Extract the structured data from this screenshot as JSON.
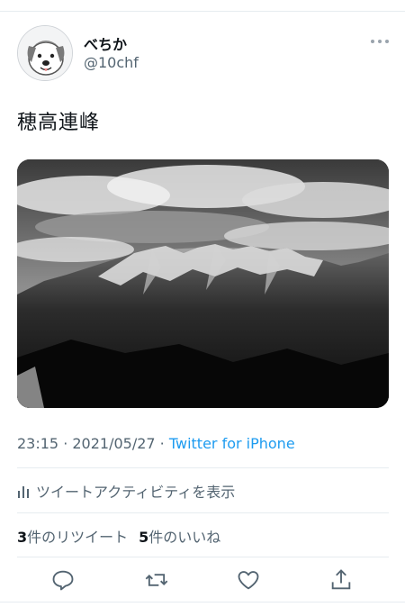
{
  "user": {
    "display_name": "べちか",
    "handle": "@10chf",
    "avatar_icon": "dog-avatar-icon"
  },
  "tweet": {
    "text": "穂高連峰",
    "photo": "black-and-white photo of mountain range with clouds"
  },
  "meta": {
    "time": "23:15",
    "separator": " · ",
    "date": "2021/05/27",
    "source": "Twitter for iPhone"
  },
  "activity_label": "ツイートアクティビティを表示",
  "stats": {
    "retweets_count": "3",
    "retweets_label": "件のリツイート",
    "likes_count": "5",
    "likes_label": "件のいいね"
  },
  "actions": [
    "reply-icon",
    "retweet-icon",
    "like-icon",
    "share-icon"
  ],
  "colors": {
    "link": "#1d9bf0",
    "secondary": "#536471",
    "border": "#e6ecf0"
  }
}
